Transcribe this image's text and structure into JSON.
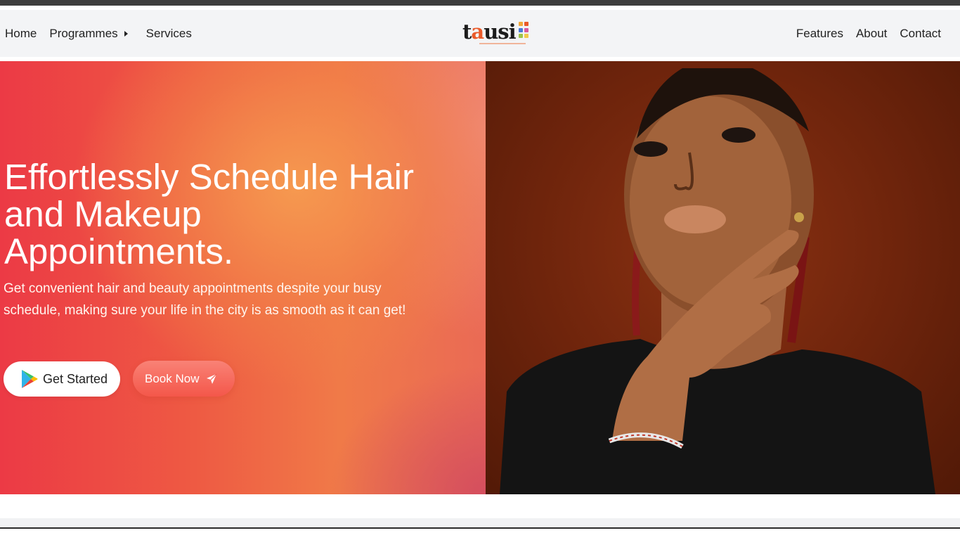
{
  "nav": {
    "left": [
      "Home",
      "Programmes",
      "Services"
    ],
    "right": [
      "Features",
      "About",
      "Contact"
    ]
  },
  "logo": {
    "prefix": "t",
    "accent": "a",
    "suffix": "usi",
    "dot_colors": [
      "#f2a93b",
      "#ea5a2a",
      "#4a7bd8",
      "#d85aa0",
      "#9ec44a",
      "#f2c94c"
    ]
  },
  "hero": {
    "title": "Effortlessly Schedule Hair and Makeup Appointments.",
    "subtitle": "Get convenient hair and beauty appointments despite your busy schedule, making sure your life in the city is as smooth as it can get!",
    "cta_primary": "Get Started",
    "cta_secondary": "Book Now",
    "icons": {
      "primary": "google-play-icon",
      "secondary": "send-icon"
    }
  },
  "colors": {
    "accent": "#f4574a",
    "gradient_left": "#ec3a45",
    "gradient_mid": "#f07a48",
    "photo_bg": "#6e240c"
  }
}
